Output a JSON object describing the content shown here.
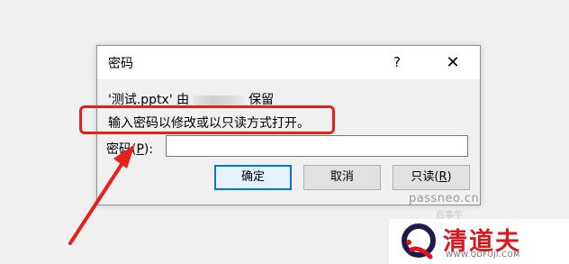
{
  "dialog": {
    "title": "密码",
    "help_glyph": "?",
    "close_glyph": "✕",
    "file_name": "'测试.pptx'",
    "owner_prefix": "由",
    "owner_suffix": "保留",
    "instruction": "输入密码以修改或以只读方式打开。",
    "password_label_pre": "密码(",
    "password_label_key": "P",
    "password_label_post": "):",
    "password_value": "",
    "ok_label": "确定",
    "cancel_label": "取消",
    "readonly_label_pre": "只读(",
    "readonly_label_key": "R",
    "readonly_label_post": ")"
  },
  "annotation": {
    "highlight_color": "#e8201a"
  },
  "watermark": {
    "site": "passneo.cn",
    "site_sub": "百事牛"
  },
  "logo": {
    "name": "清道夫",
    "url": "WWW.QDFUJI.COM",
    "brand_color": "#e0141c"
  }
}
